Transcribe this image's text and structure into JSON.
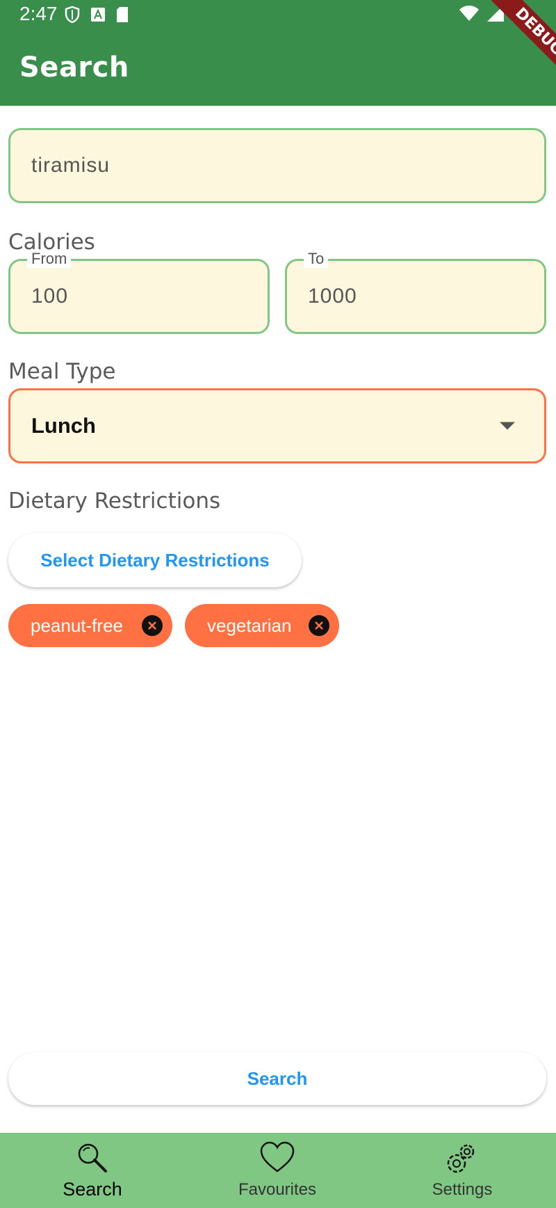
{
  "status_bar": {
    "time": "2:47"
  },
  "app_bar": {
    "title": "Search",
    "debug_banner": "DEBUG"
  },
  "search": {
    "query": "tiramisu"
  },
  "calories": {
    "label": "Calories",
    "from_label": "From",
    "from_value": "100",
    "to_label": "To",
    "to_value": "1000"
  },
  "meal_type": {
    "label": "Meal Type",
    "selected": "Lunch"
  },
  "dietary": {
    "label": "Dietary Restrictions",
    "select_button": "Select Dietary Restrictions",
    "chips": [
      "peanut-free",
      "vegetarian"
    ]
  },
  "search_button": "Search",
  "bottom_nav": {
    "items": [
      {
        "label": "Search",
        "icon": "search-icon",
        "active": true
      },
      {
        "label": "Favourites",
        "icon": "heart-icon",
        "active": false
      },
      {
        "label": "Settings",
        "icon": "gear-icon",
        "active": false
      }
    ]
  },
  "colors": {
    "app_bar": "#388e4a",
    "nav": "#81c784",
    "field_bg": "#fdf7dd",
    "field_border": "#81c784",
    "accent": "#ff7043",
    "link": "#2196f3"
  }
}
